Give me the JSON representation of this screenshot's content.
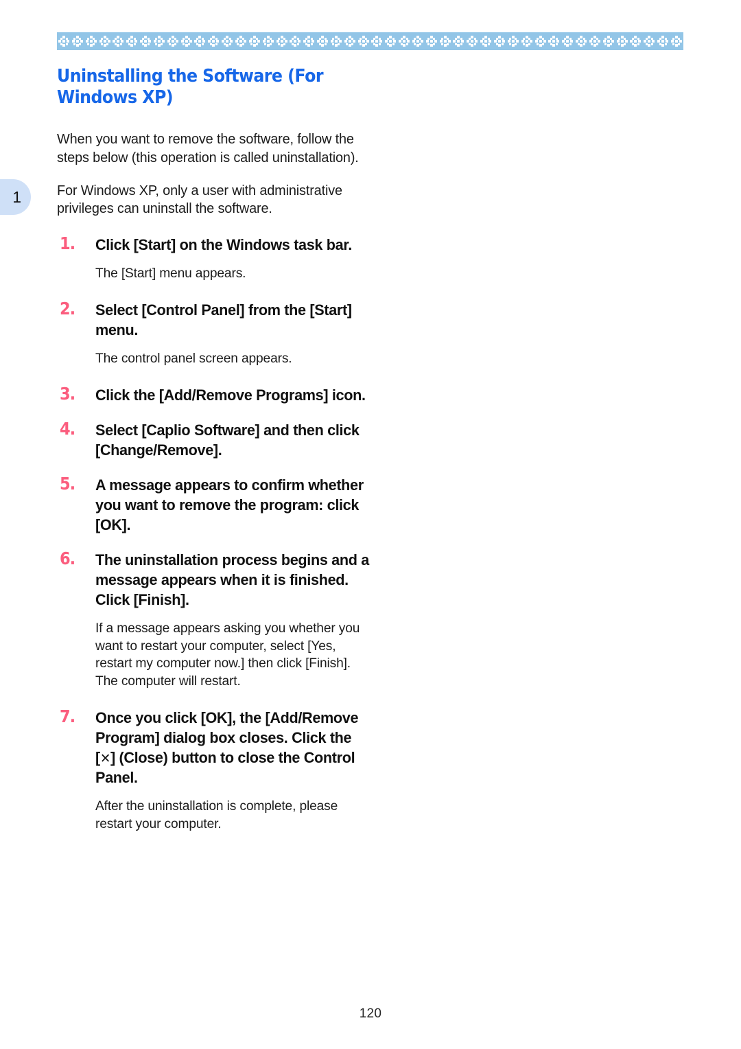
{
  "document": {
    "chapter_tab": "1",
    "page_number": "120",
    "accent_heading_color": "#1767e8",
    "accent_step_number_color": "#fb5d7e",
    "ornament_band_color": "#92c5e7",
    "chapter_tab_color": "#cfe0f7"
  },
  "heading": {
    "text": "Uninstalling the Software (For Windows XP)"
  },
  "intro": {
    "paragraph_1": "When you want to remove the software, follow the steps below (this operation is called uninstallation).",
    "paragraph_2": "For Windows XP, only a user with administrative privileges can uninstall the software."
  },
  "steps": [
    {
      "number": "1.",
      "title": "Click [Start] on the Windows task bar.",
      "note": "The [Start] menu appears."
    },
    {
      "number": "2.",
      "title": "Select [Control Panel] from the [Start] menu.",
      "note": "The control panel screen appears."
    },
    {
      "number": "3.",
      "title": "Click the [Add/Remove Programs] icon.",
      "note": ""
    },
    {
      "number": "4.",
      "title": "Select [Caplio Software] and then click [Change/Remove].",
      "note": ""
    },
    {
      "number": "5.",
      "title": "A message appears to confirm whether you want to remove the program: click [OK].",
      "note": ""
    },
    {
      "number": "6.",
      "title": "The uninstallation process begins and a message appears when it is finished. Click [Finish].",
      "note": "If a message appears asking you whether you want to restart your computer, select [Yes, restart my computer now.] then click [Finish]. The computer will restart."
    },
    {
      "number": "7.",
      "title_before_glyph": "Once you click [OK], the [Add/Remove Program] dialog box closes. Click the [",
      "close_glyph": "✕",
      "title_after_glyph": "] (Close) button to close the Control Panel.",
      "note": "After the uninstallation is complete, please restart your computer."
    }
  ]
}
